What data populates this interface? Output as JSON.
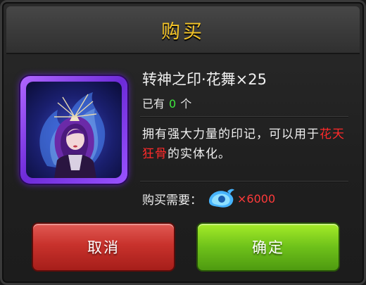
{
  "dialog": {
    "title": "购买"
  },
  "item": {
    "icon": "purple-haired-character-portrait",
    "rarity_color": "#9a53ff",
    "name": "转神之印·花舞×25",
    "owned_prefix": "已有",
    "owned_count": "0",
    "owned_suffix": "个",
    "description_part1": "拥有强大力量的印记，可以用于",
    "description_highlight": "花天狂骨",
    "description_part2": "的实体化。"
  },
  "cost": {
    "label": "购买需要：",
    "currency_icon": "blue-spirit-flame-icon",
    "amount": "×6000",
    "amount_color": "#ff3a3a"
  },
  "buttons": {
    "cancel_label": "取消",
    "confirm_label": "确定"
  }
}
